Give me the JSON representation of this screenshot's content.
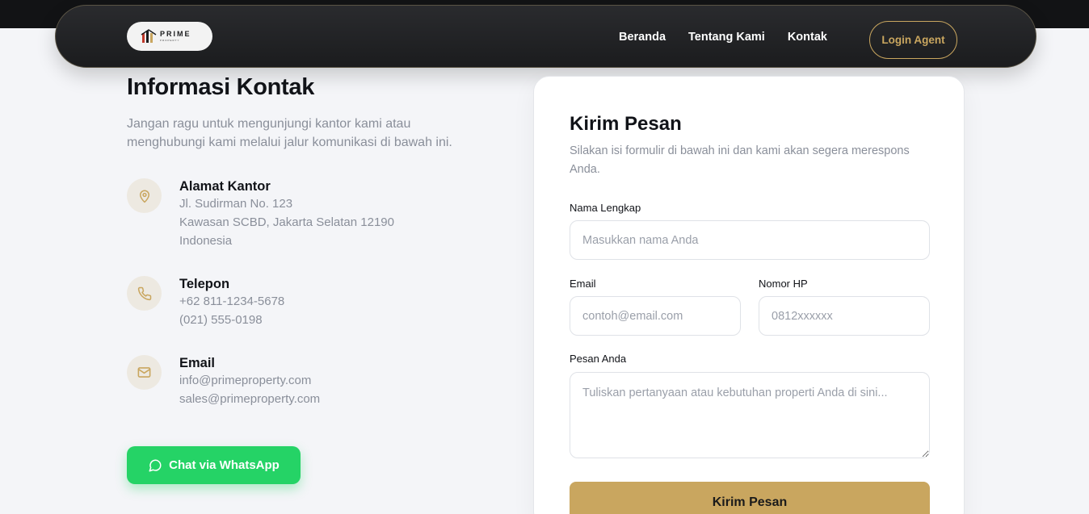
{
  "header": {
    "logo": {
      "brand": "PRIME",
      "tagline": "PROPERTY"
    },
    "nav": [
      "Beranda",
      "Tentang Kami",
      "Kontak"
    ],
    "login_label": "Login Agent"
  },
  "info": {
    "title": "Informasi Kontak",
    "intro": "Jangan ragu untuk mengunjungi kantor kami atau menghubungi kami melalui jalur komunikasi di bawah ini.",
    "address": {
      "title": "Alamat Kantor",
      "lines": [
        "Jl. Sudirman No. 123",
        "Kawasan SCBD, Jakarta Selatan 12190",
        "Indonesia"
      ]
    },
    "phone": {
      "title": "Telepon",
      "lines": [
        "+62 811-1234-5678",
        "(021) 555-0198"
      ]
    },
    "email": {
      "title": "Email",
      "lines": [
        "info@primeproperty.com",
        "sales@primeproperty.com"
      ]
    },
    "whatsapp_label": "Chat via WhatsApp"
  },
  "form": {
    "title": "Kirim Pesan",
    "subtitle": "Silakan isi formulir di bawah ini dan kami akan segera merespons Anda.",
    "name": {
      "label": "Nama Lengkap",
      "placeholder": "Masukkan nama Anda",
      "value": ""
    },
    "email": {
      "label": "Email",
      "placeholder": "contoh@email.com",
      "value": ""
    },
    "phone": {
      "label": "Nomor HP",
      "placeholder": "0812xxxxxx",
      "value": ""
    },
    "message": {
      "label": "Pesan Anda",
      "placeholder": "Tuliskan pertanyaan atau kebutuhan properti Anda di sini...",
      "value": ""
    },
    "submit_label": "Kirim Pesan"
  },
  "colors": {
    "accent_gold": "#c9a65f",
    "whatsapp_green": "#25d366",
    "nav_dark": "#1b1c1e"
  },
  "icons": [
    "map-pin-icon",
    "phone-icon",
    "mail-icon",
    "whatsapp-chat-icon"
  ]
}
